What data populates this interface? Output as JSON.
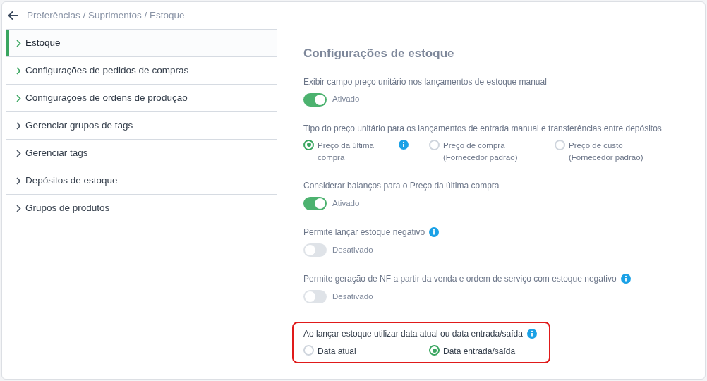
{
  "breadcrumb": "Preferências / Suprimentos / Estoque",
  "menu": [
    {
      "label": "Estoque",
      "selected": true,
      "color": "#3aa660"
    },
    {
      "label": "Configurações de pedidos de compras",
      "selected": false,
      "color": "#3aa660"
    },
    {
      "label": "Configurações de ordens de produção",
      "selected": false,
      "color": "#3aa660"
    },
    {
      "label": "Gerenciar grupos de tags",
      "selected": false,
      "color": "#4b5563"
    },
    {
      "label": "Gerenciar tags",
      "selected": false,
      "color": "#4b5563"
    },
    {
      "label": "Depósitos de estoque",
      "selected": false,
      "color": "#4b5563"
    },
    {
      "label": "Grupos de produtos",
      "selected": false,
      "color": "#4b5563"
    }
  ],
  "title": "Configurações de estoque",
  "settings": [
    {
      "kind": "toggle",
      "highlighted": false,
      "label": "Exibir campo preço unitário nos lançamentos de estoque manual",
      "info": false,
      "on": true,
      "state": "Ativado"
    },
    {
      "kind": "radio",
      "highlighted": false,
      "label": "Tipo do preço unitário para os lançamentos de entrada manual e transferências entre depósitos",
      "info": false,
      "options": [
        {
          "label": "Preço da última compra",
          "selected": true,
          "info": true
        },
        {
          "label": "Preço de compra (Fornecedor padrão)",
          "selected": false,
          "info": false
        },
        {
          "label": "Preço de custo (Fornecedor padrão)",
          "selected": false,
          "info": false
        }
      ]
    },
    {
      "kind": "toggle",
      "highlighted": false,
      "label": "Considerar balanços para o Preço da última compra",
      "info": false,
      "on": true,
      "state": "Ativado"
    },
    {
      "kind": "toggle",
      "highlighted": false,
      "label": "Permite lançar estoque negativo",
      "info": true,
      "on": false,
      "state": "Desativado"
    },
    {
      "kind": "toggle",
      "highlighted": false,
      "label": "Permite geração de NF a partir da venda e ordem de serviço com estoque negativo",
      "info": true,
      "on": false,
      "state": "Desativado"
    },
    {
      "kind": "radio",
      "highlighted": true,
      "label": "Ao lançar estoque utilizar data atual ou data entrada/saída",
      "info": true,
      "options": [
        {
          "label": "Data atual",
          "selected": false,
          "info": false
        },
        {
          "label": "Data entrada/saída",
          "selected": true,
          "info": false
        }
      ]
    }
  ]
}
